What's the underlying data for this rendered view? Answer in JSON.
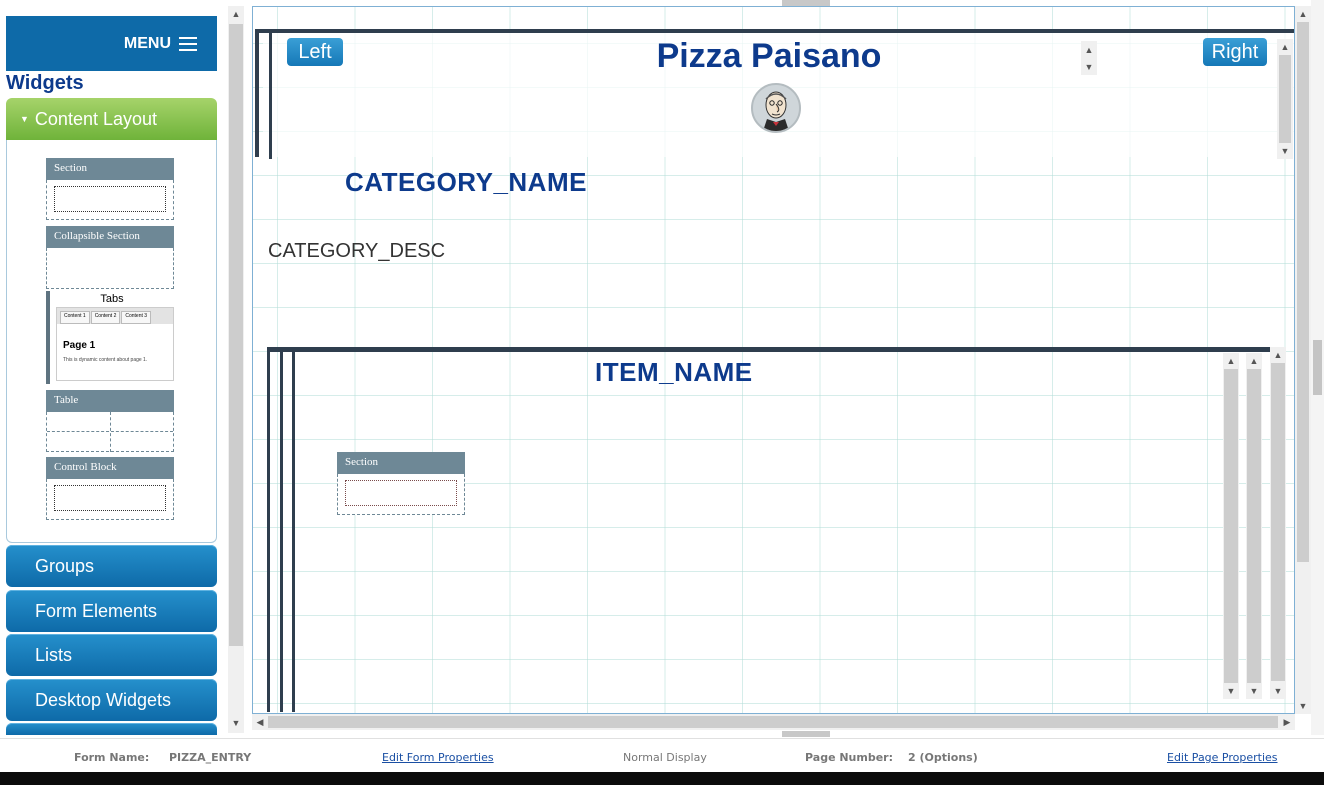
{
  "menu": {
    "label": "MENU"
  },
  "widgets": {
    "title": "Widgets",
    "active_group": "Content Layout",
    "items": {
      "section": "Section",
      "collapsible": "Collapsible Section",
      "tabs": "Tabs",
      "tabs_preview": {
        "tab1": "Content 1",
        "tab2": "Content 2",
        "tab3": "Content 3",
        "page": "Page 1",
        "desc": "This is dynamic content about page 1."
      },
      "table": "Table",
      "control_block": "Control Block"
    },
    "groups": [
      "Groups",
      "Form Elements",
      "Lists",
      "Desktop Widgets"
    ]
  },
  "canvas": {
    "left_button": "Left",
    "right_button": "Right",
    "page_title": "Pizza Paisano",
    "category_name": "CATEGORY_NAME",
    "category_desc": "CATEGORY_DESC",
    "item_name": "ITEM_NAME",
    "inner_section": "Section"
  },
  "status": {
    "form_name_label": "Form Name:",
    "form_name": "PIZZA_ENTRY",
    "edit_form": "Edit Form Properties",
    "display_mode": "Normal Display",
    "page_number_label": "Page Number:",
    "page_number": "2 (Options)",
    "edit_page": "Edit Page Properties"
  },
  "icons": [
    "hamburger-icon",
    "caret-down-icon",
    "avatar-caricature-icon",
    "scroll-up-arrow-icon",
    "scroll-down-arrow-icon",
    "scroll-left-arrow-icon",
    "scroll-right-arrow-icon"
  ],
  "colors": {
    "brand_blue": "#0e6aa8",
    "title_navy": "#0d3a8c",
    "active_green": "#7dbd44",
    "frame_dark": "#2f3e4e",
    "widget_slate": "#6e8896"
  }
}
